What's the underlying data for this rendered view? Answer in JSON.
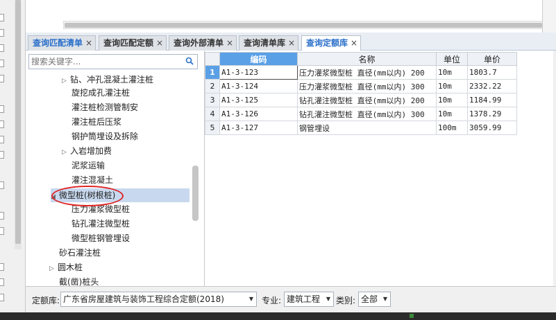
{
  "tabs": [
    {
      "label": "查询匹配清单",
      "close": "×",
      "style": "blue"
    },
    {
      "label": "查询匹配定额",
      "close": "×",
      "style": "normal"
    },
    {
      "label": "查询外部清单",
      "close": "×",
      "style": "normal"
    },
    {
      "label": "查询清单库",
      "close": "×",
      "style": "normal"
    },
    {
      "label": "查询定额库",
      "close": "×",
      "style": "active"
    }
  ],
  "search": {
    "placeholder": "搜索关键字..."
  },
  "tree": [
    {
      "label": "钻、冲孔混凝土灌注桩",
      "arrow": "▷"
    },
    {
      "label": "旋挖成孔灌注桩",
      "arrow": ""
    },
    {
      "label": "灌注桩检测管制安",
      "arrow": ""
    },
    {
      "label": "灌注桩后压浆",
      "arrow": ""
    },
    {
      "label": "钢护筒埋设及拆除",
      "arrow": ""
    },
    {
      "label": "入岩增加费",
      "arrow": "▷"
    },
    {
      "label": "泥浆运输",
      "arrow": ""
    },
    {
      "label": "灌注混凝土",
      "arrow": ""
    },
    {
      "label": "微型桩(树根桩)",
      "arrow": "◢"
    },
    {
      "label": "压力灌浆微型桩",
      "arrow": ""
    },
    {
      "label": "钻孔灌注微型桩",
      "arrow": ""
    },
    {
      "label": "微型桩钢管埋设",
      "arrow": ""
    },
    {
      "label": "砂石灌注桩",
      "arrow": ""
    },
    {
      "label": "圆木桩",
      "arrow": "▷"
    },
    {
      "label": "截(凿)桩头",
      "arrow": ""
    }
  ],
  "grid": {
    "headers": [
      "编码",
      "名称",
      "单位",
      "单价"
    ],
    "rows": [
      {
        "n": "1",
        "code": "A1-3-123",
        "name": "压力灌浆微型桩 直径(mm以内) 200",
        "unit": "10m",
        "price": "1803.7"
      },
      {
        "n": "2",
        "code": "A1-3-124",
        "name": "压力灌浆微型桩 直径(mm以内) 300",
        "unit": "10m",
        "price": "2332.22"
      },
      {
        "n": "3",
        "code": "A1-3-125",
        "name": "钻孔灌注微型桩 直径(mm以内) 200",
        "unit": "10m",
        "price": "1184.99"
      },
      {
        "n": "4",
        "code": "A1-3-126",
        "name": "钻孔灌注微型桩 直径(mm以内) 300",
        "unit": "10m",
        "price": "1378.29"
      },
      {
        "n": "5",
        "code": "A1-3-127",
        "name": "钢管埋设",
        "unit": "100m",
        "price": "3059.99"
      }
    ]
  },
  "bottom": {
    "quota_label": "定额库:",
    "quota_value": "广东省房屋建筑与装饰工程综合定额(2018)",
    "major_label": "专业:",
    "major_value": "建筑工程",
    "type_label": "类别:",
    "type_value": "全部",
    "dropdown": "▼"
  },
  "colors": {
    "accent": "#2a6fc9",
    "header_selected": "#5aa0e6",
    "tree_selected": "#c8d9ef",
    "annotation": "#e02424"
  }
}
